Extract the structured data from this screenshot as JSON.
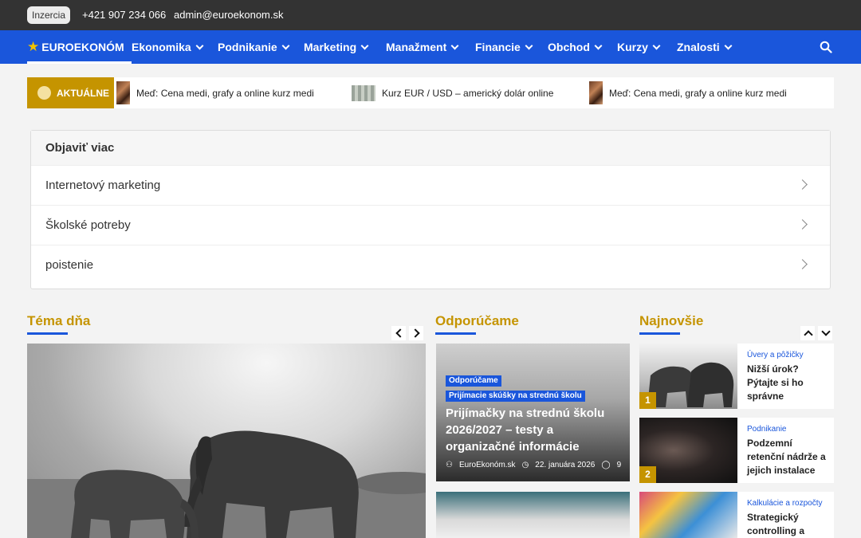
{
  "topbar": {
    "badge": "Inzercia",
    "phone": "+421 907 234 066",
    "email": "admin@euroekonom.sk"
  },
  "nav": {
    "brand": "EUROEKONÓM",
    "items": [
      "Ekonomika",
      "Podnikanie",
      "Marketing",
      "Manažment",
      "Financie",
      "Obchod",
      "Kurzy",
      "Znalosti"
    ]
  },
  "ticker": {
    "label": "AKTUÁLNE",
    "items": [
      "Meď: Cena medi, grafy a online kurz medi",
      "Kurz EUR / USD – americký dolár online",
      "Meď: Cena medi, grafy a online kurz medi"
    ]
  },
  "discover": {
    "title": "Objaviť viac",
    "items": [
      "Internetový marketing",
      "Školské potreby",
      "poistenie"
    ]
  },
  "sections": {
    "tema": "Téma dňa",
    "odporucame": "Odporúčame",
    "najnovsie": "Najnovšie"
  },
  "recommended": {
    "tags": [
      "Odporúčame",
      "Prijímacie skúšky na strednú školu"
    ],
    "title": "Prijímačky na strednú školu 2026/2027 – testy a organizačné informácie",
    "author": "EuroEkonóm.sk",
    "date": "22. januára 2026",
    "comments": "9"
  },
  "latest": [
    {
      "num": "1",
      "category": "Úvery a pôžičky",
      "title": "Nižší úrok? Pýtajte si ho správne"
    },
    {
      "num": "2",
      "category": "Podnikanie",
      "title": "Podzemní retenční nádrže a jejich instalace"
    },
    {
      "num": "",
      "category": "Kalkulácie a rozpočty",
      "title": "Strategický controlling a"
    }
  ]
}
